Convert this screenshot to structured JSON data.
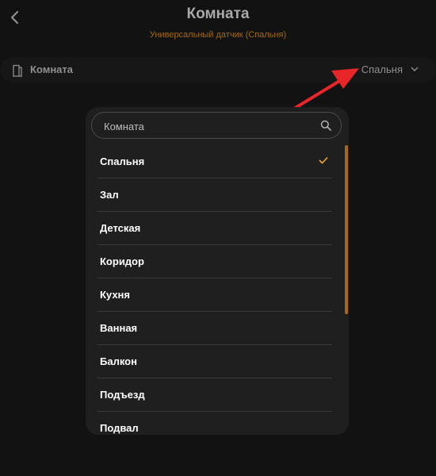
{
  "header": {
    "title": "Комната",
    "subtitle": "Универсальный датчик (Спальня)"
  },
  "room_field": {
    "label": "Комната",
    "value": "Спальня"
  },
  "dropdown": {
    "search_placeholder": "Комната",
    "selected": "Спальня",
    "items": [
      {
        "label": "Спальня",
        "selected": true
      },
      {
        "label": "Зал"
      },
      {
        "label": "Детская"
      },
      {
        "label": "Коридор"
      },
      {
        "label": "Кухня"
      },
      {
        "label": "Ванная"
      },
      {
        "label": "Балкон"
      },
      {
        "label": "Подъезд"
      },
      {
        "label": "Подвал"
      }
    ]
  },
  "colors": {
    "accent": "#f5a623",
    "annotation_arrow": "#e8262a"
  },
  "icons": [
    "back-arrow-icon",
    "door-icon",
    "chevron-down-icon",
    "search-icon",
    "check-icon"
  ]
}
